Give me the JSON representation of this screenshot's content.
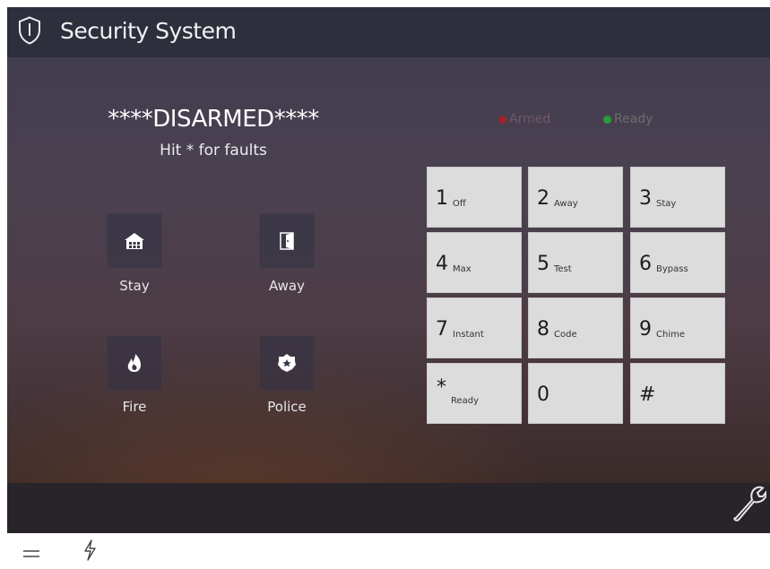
{
  "header": {
    "title": "Security System",
    "icon": "shield-icon"
  },
  "status": {
    "main": "****DISARMED****",
    "sub": "Hit * for faults"
  },
  "indicators": [
    {
      "label": "Armed",
      "color": "#a0242a"
    },
    {
      "label": "Ready",
      "color": "#2d9a3a"
    }
  ],
  "actions": {
    "stay": {
      "label": "Stay",
      "icon": "house-icon"
    },
    "away": {
      "label": "Away",
      "icon": "door-icon"
    },
    "fire": {
      "label": "Fire",
      "icon": "fire-icon"
    },
    "police": {
      "label": "Police",
      "icon": "police-badge-icon"
    }
  },
  "keypad": [
    {
      "num": "1",
      "sub": "Off"
    },
    {
      "num": "2",
      "sub": "Away"
    },
    {
      "num": "3",
      "sub": "Stay"
    },
    {
      "num": "4",
      "sub": "Max"
    },
    {
      "num": "5",
      "sub": "Test"
    },
    {
      "num": "6",
      "sub": "Bypass"
    },
    {
      "num": "7",
      "sub": "Instant"
    },
    {
      "num": "8",
      "sub": "Code"
    },
    {
      "num": "9",
      "sub": "Chime"
    },
    {
      "num": "*",
      "sub": "Ready"
    },
    {
      "num": "0",
      "sub": ""
    },
    {
      "num": "#",
      "sub": ""
    }
  ],
  "toolbar": {
    "settings_icon": "wrench-icon",
    "menu_icon": "menu-icon",
    "power_icon": "lightning-icon"
  },
  "colors": {
    "header_bg": "#2d2f3c",
    "key_bg": "#dcdcdc",
    "text": "#ffffff"
  }
}
